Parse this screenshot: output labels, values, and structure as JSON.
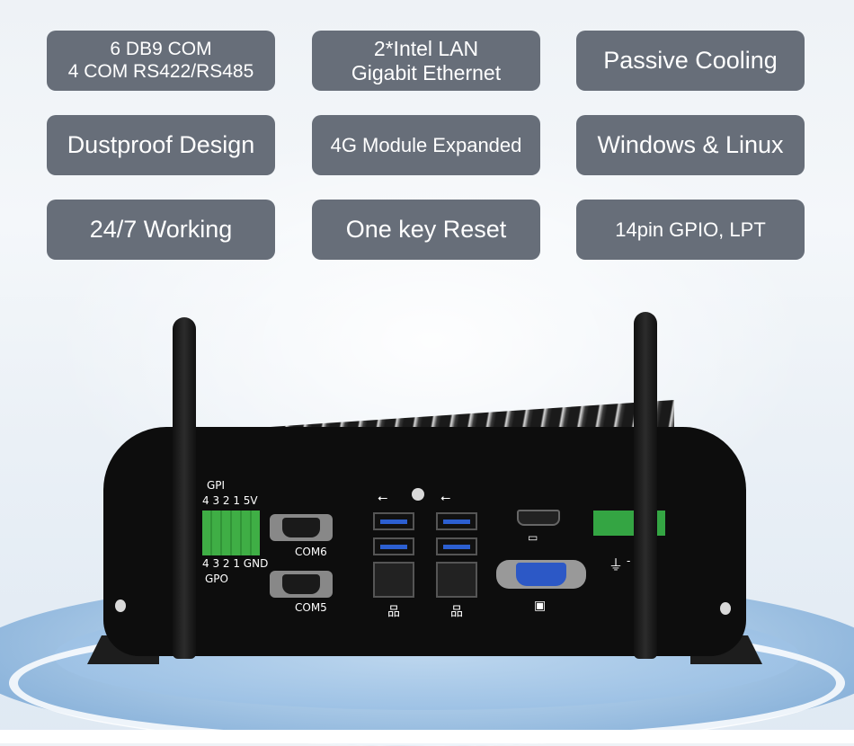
{
  "features": [
    {
      "lines": [
        "6 DB9 COM",
        "4 COM RS422/RS485"
      ]
    },
    {
      "lines": [
        "2*Intel LAN",
        "Gigabit Ethernet"
      ]
    },
    {
      "lines": [
        "Passive Cooling"
      ]
    },
    {
      "lines": [
        "Dustproof Design"
      ]
    },
    {
      "lines": [
        "4G Module Expanded"
      ]
    },
    {
      "lines": [
        "Windows & Linux"
      ]
    },
    {
      "lines": [
        "24/7 Working"
      ]
    },
    {
      "lines": [
        "One key Reset"
      ]
    },
    {
      "lines": [
        "14pin GPIO, LPT"
      ]
    }
  ],
  "device": {
    "gpi_label": "GPI",
    "gpi_pins": "4 3 2 1 5V",
    "gpo_pins": "4 3 2 1 GND",
    "gpo_label": "GPO",
    "com6_label": "COM6",
    "com5_label": "COM5",
    "icons": {
      "usb": "usb-icon",
      "lan": "network-icon",
      "hdmi": "hdmi-icon",
      "vga": "monitor-icon",
      "ground": "ground-icon"
    },
    "ground_suffix": "-"
  },
  "colors": {
    "badge_bg": "#676e79",
    "badge_text": "#ffffff",
    "gpio_green": "#3fae45",
    "usb_blue": "#2c5fd1",
    "vga_blue": "#2c58c6"
  }
}
